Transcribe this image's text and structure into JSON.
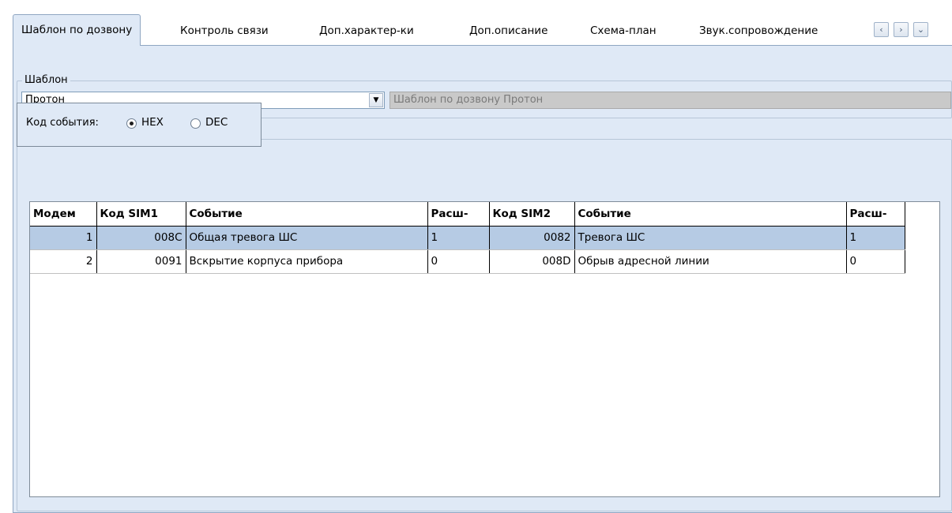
{
  "tabs": [
    {
      "label": "Шаблон по дозвону",
      "active": true
    },
    {
      "label": "Контроль связи"
    },
    {
      "label": "Доп.характер-ки"
    },
    {
      "label": "Доп.описание"
    },
    {
      "label": "Схема-план"
    },
    {
      "label": "Звук.сопровождение"
    }
  ],
  "template_group": {
    "legend": "Шаблон",
    "combo_value": "Протон",
    "description": "Шаблон по дозвону Протон"
  },
  "event_code": {
    "label": "Код события:",
    "options": [
      "HEX",
      "DEC"
    ],
    "selected": "HEX"
  },
  "grid": {
    "columns": [
      "Модем",
      "Код SIM1",
      "Событие",
      "Расш-",
      "Код SIM2",
      "Событие",
      "Расш-"
    ],
    "rows": [
      [
        "1",
        "008C",
        "Общая тревога ШС",
        "1",
        "0082",
        "Тревога ШС",
        "1"
      ],
      [
        "2",
        "0091",
        "Вскрытие корпуса прибора",
        "0",
        "008D",
        "Обрыв адресной линии",
        "0"
      ]
    ],
    "selected_row": 0
  },
  "icons": {
    "tab_prev": "chevron-left-icon",
    "tab_next": "chevron-right-icon",
    "tab_menu": "chevron-down-icon",
    "combo_dropdown": "triangle-down-icon"
  }
}
